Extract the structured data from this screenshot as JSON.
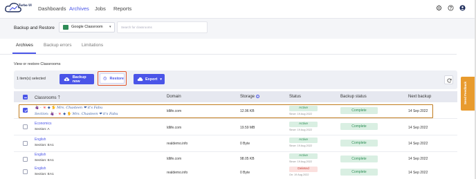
{
  "brand": {
    "name": "Turbo UI",
    "accent": "#4a55e8"
  },
  "nav": [
    {
      "label": "Dashboards",
      "active": false
    },
    {
      "label": "Archives",
      "active": true
    },
    {
      "label": "Jobs",
      "active": false
    },
    {
      "label": "Reports",
      "active": false
    }
  ],
  "header": {
    "title": "Backup and Restore",
    "source": "Google Classroom",
    "search_placeholder": "Search for classrooms"
  },
  "tabs": [
    {
      "label": "Archives",
      "active": true
    },
    {
      "label": "Backup errors",
      "active": false
    },
    {
      "label": "Limitations",
      "active": false
    }
  ],
  "section_title": "View or restore Classrooms",
  "toolbar": {
    "selected": "1 item(s) selected",
    "backup_now": "Backup now",
    "restore": "Restore",
    "export": "Export"
  },
  "table": {
    "columns": [
      "Classrooms",
      "Domain",
      "Storage",
      "Status",
      "Backup status",
      "Next backup"
    ],
    "rows": [
      {
        "name": "🍇 - 🍬 ◆ 🐈 Mrs. Chasteen ❤ it's Fabu",
        "section": "Section: 🍇 - 🍬 ◆ 🐈 Mrs. Chasteen ❤ it's Fabu",
        "domain": "ldlife.com",
        "storage": "12.96 KB",
        "status": "Active",
        "since": "Since: 19 Aug 2022",
        "backup": "Complete",
        "next": "14 Sep 2022",
        "checked": true
      },
      {
        "name": "Economics",
        "section": "Section: A",
        "domain": "ldlife.com",
        "storage": "19.59 MB",
        "status": "Active",
        "since": "Since: 19 Aug 2022",
        "backup": "Complete",
        "next": "14 Sep 2022",
        "checked": false
      },
      {
        "name": "English",
        "section": "Section: EA1",
        "domain": "realdemo.info",
        "storage": "0 Byte",
        "status": "Active",
        "since": "Since: 19 Aug 2022",
        "backup": "Complete",
        "next": "14 Sep 2022",
        "checked": false
      },
      {
        "name": "English",
        "section": "Section: EA1",
        "domain": "ldlife.com",
        "storage": "98.05 KB",
        "status": "Active",
        "since": "Since: 19 Aug 2022",
        "backup": "Complete",
        "next": "14 Sep 2022",
        "checked": false
      },
      {
        "name": "English",
        "section": "Section: EA1",
        "domain": "realdemo.info",
        "storage": "0 Byte",
        "status": "Deleted",
        "since": "On: 19 Aug 2022",
        "backup": "Complete",
        "next": "14 Sep 2022",
        "checked": false
      }
    ]
  },
  "feedback": "Send Feedback",
  "icons": [
    "cloud-logo-icon",
    "gear-icon",
    "help-icon",
    "user-icon",
    "classroom-icon",
    "chevron-down-icon",
    "cloud-upload-icon",
    "restore-icon",
    "sort-up-icon",
    "info-icon",
    "refresh-icon"
  ],
  "colors": {
    "primary": "#4a55e8",
    "active_badge": "#2f8f57",
    "deleted_badge": "#c9453c",
    "highlight_orange": "#e3552a",
    "feedback": "#e89b2e"
  }
}
